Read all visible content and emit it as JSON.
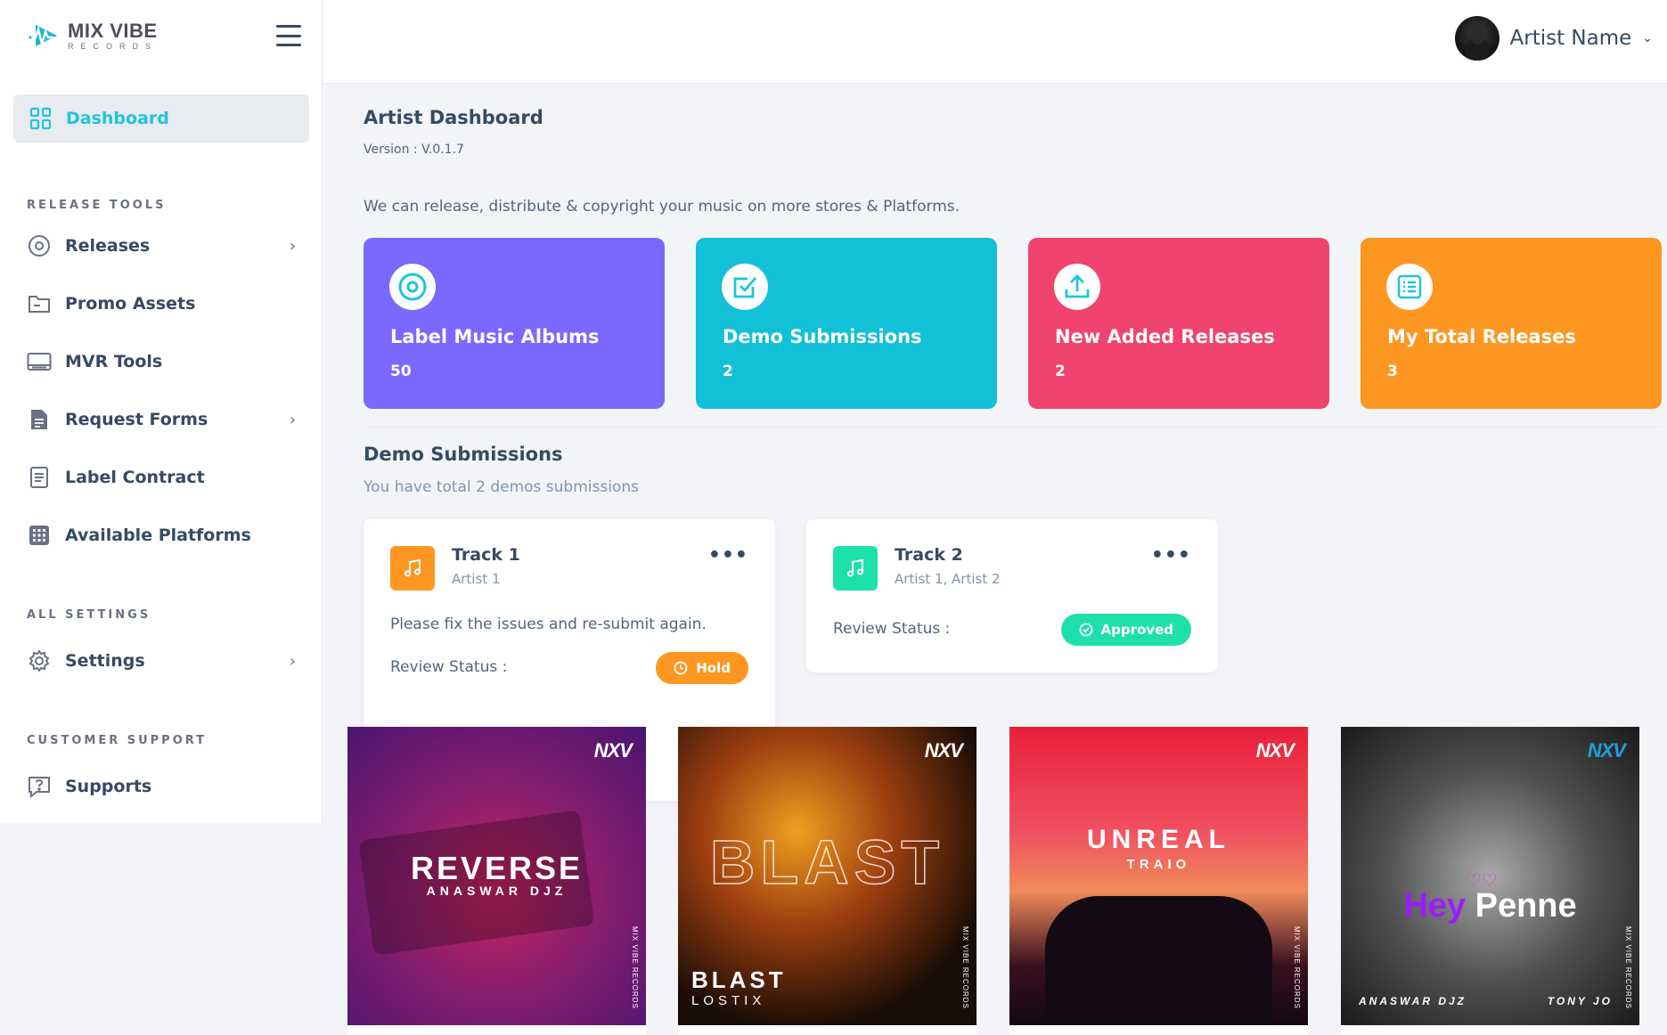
{
  "brand": {
    "name": "MIX VIBE",
    "sub": "RECORDS"
  },
  "sidebar": {
    "active": "Dashboard",
    "sections": [
      {
        "title": "RELEASE TOOLS"
      },
      {
        "title": "ALL SETTINGS"
      },
      {
        "title": "CUSTOMER SUPPORT"
      }
    ],
    "items": [
      {
        "label": "Releases",
        "icon": "disc-icon",
        "chevron": true
      },
      {
        "label": "Promo Assets",
        "icon": "folder-icon",
        "chevron": false
      },
      {
        "label": "MVR Tools",
        "icon": "monitor-icon",
        "chevron": false
      },
      {
        "label": "Request Forms",
        "icon": "file-icon",
        "chevron": true
      },
      {
        "label": "Label Contract",
        "icon": "document-icon",
        "chevron": false
      },
      {
        "label": "Available Platforms",
        "icon": "grid-icon",
        "chevron": false
      },
      {
        "label": "Settings",
        "icon": "gear-icon",
        "chevron": true
      },
      {
        "label": "Supports",
        "icon": "help-icon",
        "chevron": false
      }
    ]
  },
  "header": {
    "user_name": "Artist Name"
  },
  "main": {
    "title": "Artist Dashboard",
    "version": "Version : V.0.1.7",
    "tagline": "We can release, distribute & copyright your music on more stores & Platforms.",
    "stats": [
      {
        "title": "Label Music Albums",
        "value": "50",
        "color": "#7b68ff",
        "icon": "disc-icon"
      },
      {
        "title": "Demo Submissions",
        "value": "2",
        "color": "#12c0d8",
        "icon": "check-square-icon"
      },
      {
        "title": "New Added Releases",
        "value": "2",
        "color": "#f0436d",
        "icon": "upload-icon"
      },
      {
        "title": "My Total Releases",
        "value": "3",
        "color": "#fd9722",
        "icon": "list-icon"
      }
    ],
    "demos_title": "Demo Submissions",
    "demos_subtitle": "You have total 2 demos submissions",
    "demos": [
      {
        "title": "Track 1",
        "artist": "Artist 1",
        "message": "Please fix the issues and re-submit again.",
        "status_label": "Review Status :",
        "status": "Hold",
        "status_color": "#fd9722",
        "icon_color": "#fd9722"
      },
      {
        "title": "Track 2",
        "artist": "Artist 1, Artist 2",
        "message": "",
        "status_label": "Review Status :",
        "status": "Approved",
        "status_color": "#1ee0ac",
        "icon_color": "#1ee0ac"
      }
    ],
    "covers": [
      {
        "title": "REVERSE",
        "artist": "ANASWAR DJZ",
        "logo": "NXV",
        "side": "MIX VIBE RECORDS"
      },
      {
        "title": "BLAST",
        "artist": "LOSTIX",
        "logo": "NXV",
        "side": "MIX VIBE RECORDS"
      },
      {
        "title": "UNREAL",
        "artist": "TRAIO",
        "logo": "NXV",
        "side": "MIX VIBE RECORDS"
      },
      {
        "title_a": "Hey",
        "title_b": "Penne",
        "artist": "ANASWAR DJZ",
        "artist2": "TONY JO",
        "logo": "NXV",
        "side": "MIX VIBE RECORDS"
      }
    ]
  }
}
